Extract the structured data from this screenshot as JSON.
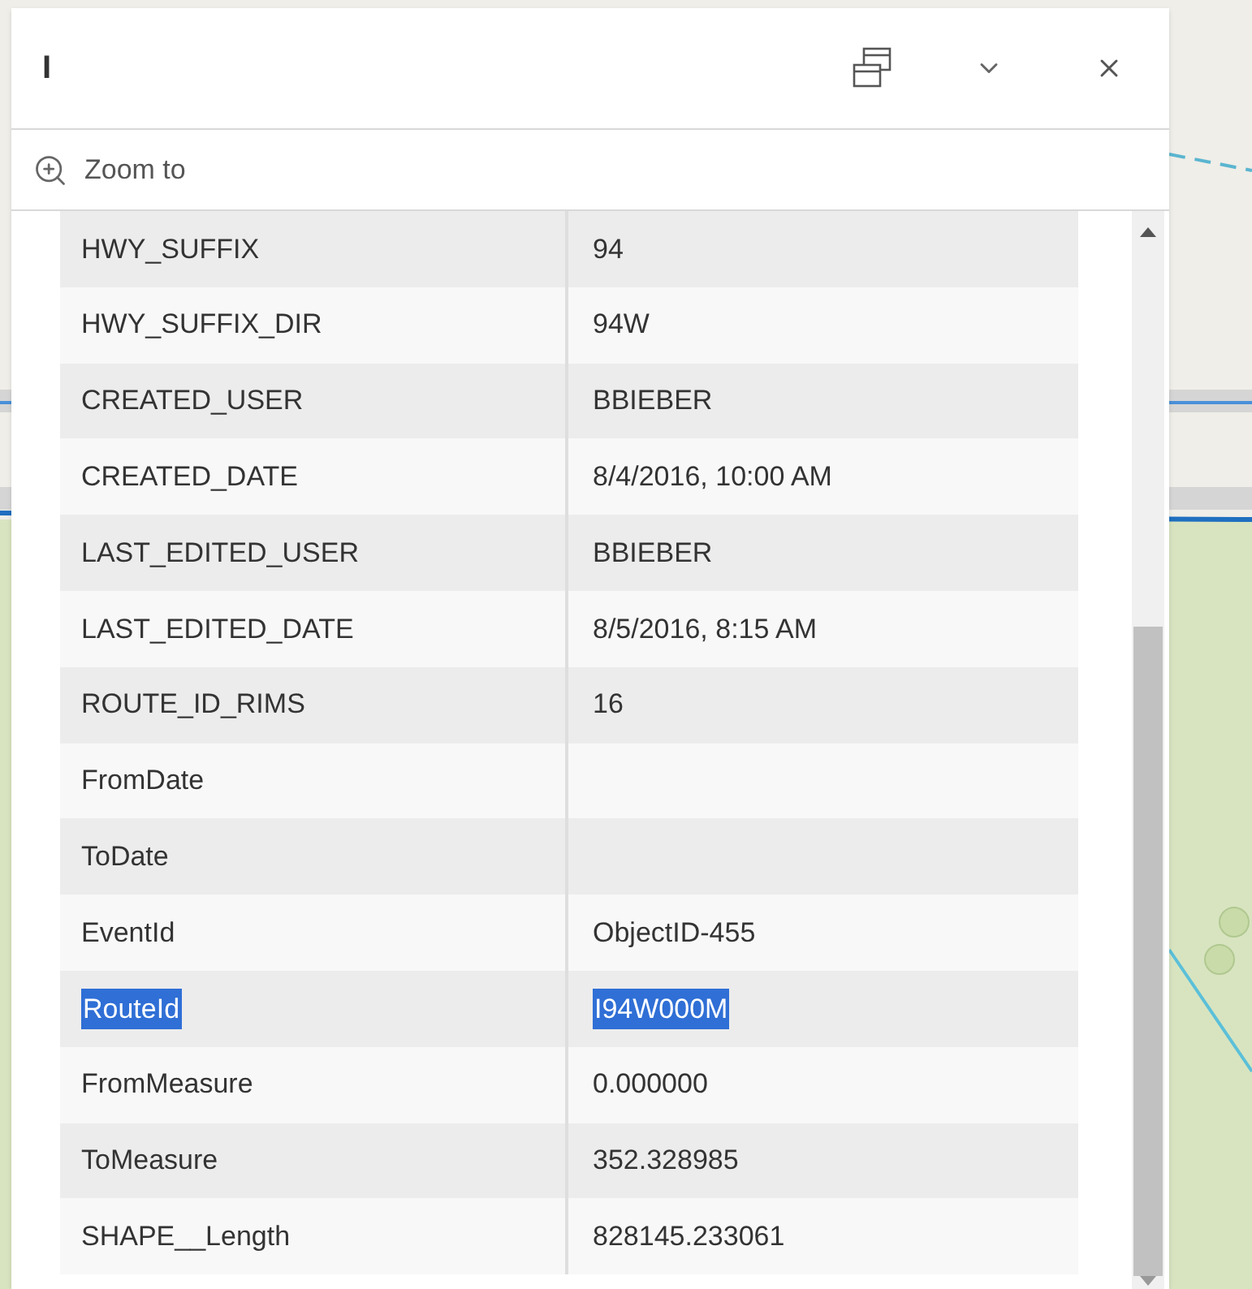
{
  "panel": {
    "title": "I",
    "zoom_action": "Zoom to"
  },
  "rows": [
    {
      "field": "HWY_SUFFIX",
      "value": "94",
      "highlighted": false
    },
    {
      "field": "HWY_SUFFIX_DIR",
      "value": "94W",
      "highlighted": false
    },
    {
      "field": "CREATED_USER",
      "value": "BBIEBER",
      "highlighted": false
    },
    {
      "field": "CREATED_DATE",
      "value": "8/4/2016, 10:00 AM",
      "highlighted": false
    },
    {
      "field": "LAST_EDITED_USER",
      "value": "BBIEBER",
      "highlighted": false
    },
    {
      "field": "LAST_EDITED_DATE",
      "value": "8/5/2016, 8:15 AM",
      "highlighted": false
    },
    {
      "field": "ROUTE_ID_RIMS",
      "value": "16",
      "highlighted": false
    },
    {
      "field": "FromDate",
      "value": "",
      "highlighted": false
    },
    {
      "field": "ToDate",
      "value": "",
      "highlighted": false
    },
    {
      "field": "EventId",
      "value": "ObjectID-455",
      "highlighted": false
    },
    {
      "field": "RouteId",
      "value": "I94W000M",
      "highlighted": true
    },
    {
      "field": "FromMeasure",
      "value": "0.000000",
      "highlighted": false
    },
    {
      "field": "ToMeasure",
      "value": "352.328985",
      "highlighted": false
    },
    {
      "field": "SHAPE__Length",
      "value": "828145.233061",
      "highlighted": false
    }
  ]
}
